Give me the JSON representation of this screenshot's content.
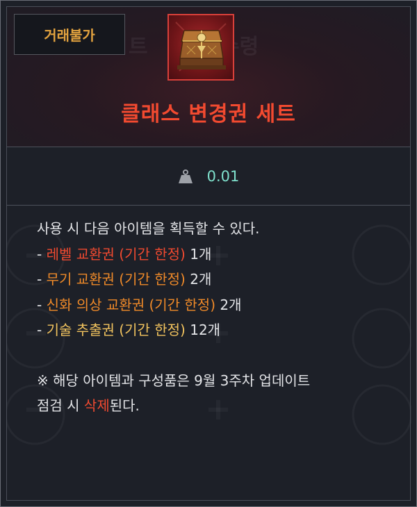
{
  "header": {
    "badge": "거래불가",
    "item_name": "클래스 변경권 세트",
    "item_icon": "treasure-chest-icon"
  },
  "stats": {
    "weight_icon": "weight-icon",
    "weight": "0.01"
  },
  "description": {
    "intro": "사용 시 다음 아이템을 획득할 수 있다.",
    "items": [
      {
        "prefix": "- ",
        "name": "레벨 교환권 (기간 한정)",
        "qty": " 1개",
        "color": "#f24a30"
      },
      {
        "prefix": "- ",
        "name": "무기 교환권 (기간 한정)",
        "qty": " 2개",
        "color": "#f08a28"
      },
      {
        "prefix": "- ",
        "name": "신화 의상 교환권 (기간 한정)",
        "qty": " 2개",
        "color": "#f08a28"
      },
      {
        "prefix": "- ",
        "name": "기술 추출권 (기간 한정)",
        "qty": " 12개",
        "color": "#f2c35e"
      }
    ],
    "notice_line1": "※ 해당 아이템과 구성품은 9월 3주차 업데이트",
    "notice_line2_a": "점검 시 ",
    "notice_line2_b": "삭제",
    "notice_line2_c": "된다."
  },
  "colors": {
    "badge_text": "#e3a33f",
    "item_name": "#f24a30",
    "weight_value": "#7fe0cc"
  }
}
